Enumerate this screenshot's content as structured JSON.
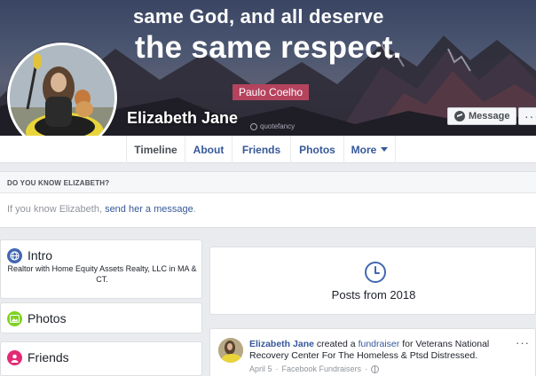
{
  "cover": {
    "quote_line1": "same God, and all deserve",
    "quote_line2": "the same respect.",
    "author": "Paulo Coelho",
    "watermark": "quotefancy"
  },
  "profile": {
    "name": "Elizabeth Jane",
    "message_label": "Message",
    "more_label": "···"
  },
  "nav": {
    "tabs": [
      {
        "label": "Timeline"
      },
      {
        "label": "About"
      },
      {
        "label": "Friends"
      },
      {
        "label": "Photos"
      },
      {
        "label": "More"
      }
    ]
  },
  "know": {
    "heading": "DO YOU KNOW ELIZABETH?",
    "prefix": "If you know Elizabeth, ",
    "link": "send her a message",
    "suffix": "."
  },
  "intro": {
    "title": "Intro",
    "text": "Realtor with Home Equity Assets Realty, LLC in MA & CT."
  },
  "photos": {
    "title": "Photos"
  },
  "friends": {
    "title": "Friends"
  },
  "posts": {
    "label": "Posts from 2018"
  },
  "feed": {
    "author": "Elizabeth Jane",
    "verb": " created a ",
    "link": "fundraiser",
    "rest": " for Veterans National Recovery Center For The Homeless & Ptsd Distressed.",
    "date": "April 5",
    "separator": "·",
    "source": "Facebook Fundraisers",
    "more": "···"
  },
  "colors": {
    "link_blue": "#365899",
    "brand_blue": "#4267b2",
    "intro_icon": "#4267b2",
    "photos_icon": "#7ed321",
    "friends_icon": "#e42a75",
    "author_badge": "#b5435e"
  }
}
